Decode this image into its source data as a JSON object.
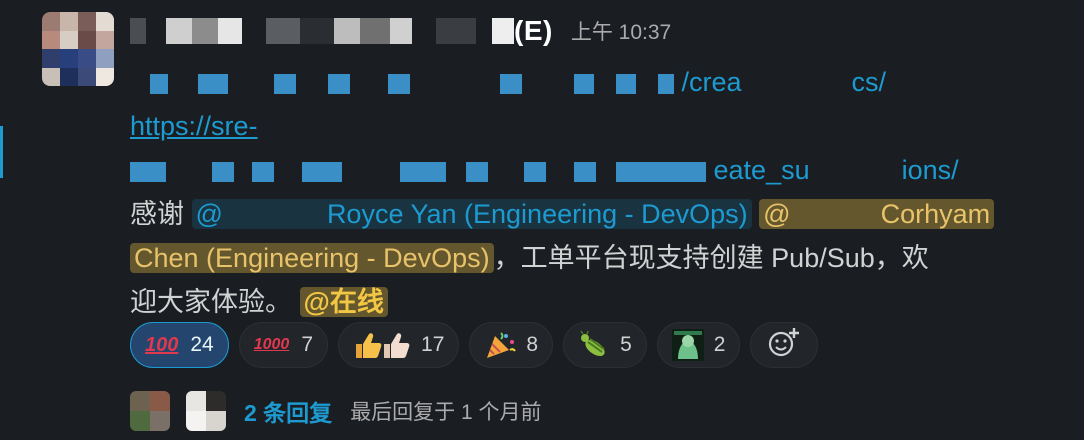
{
  "message": {
    "sender": "(E)",
    "timestamp": "上午 10:37",
    "link_line1_suffix": "/crea",
    "link_line1_end": "cs/",
    "link_line2": "https://sre-",
    "link_line3_a": "eate_su",
    "link_line3_b": "ions/",
    "text_thanks": "感谢",
    "mention1": "@",
    "mention1_name": "Royce Yan (Engineering - DevOps)",
    "mention2": "@",
    "mention2_name": "Corhyam",
    "mention2_cont": "Chen (Engineering - DevOps)",
    "body_text": "，工单平台现支持创建 Pub/Sub，欢",
    "body_text2": "迎大家体验。",
    "mention_online": "@在线"
  },
  "reactions": [
    {
      "name": "100",
      "count": "24",
      "active": true
    },
    {
      "name": "1000",
      "count": "7",
      "active": false
    },
    {
      "name": "thumbsup-skin-tones",
      "count": "17",
      "active": false
    },
    {
      "name": "party-popper",
      "count": "8",
      "active": false
    },
    {
      "name": "bug",
      "count": "5",
      "active": false
    },
    {
      "name": "custom-emoji",
      "count": "2",
      "active": false
    }
  ],
  "thread": {
    "reply_count": "2 条回复",
    "last_reply": "最后回复于 1 个月前"
  },
  "colors": {
    "link": "#1d9bd1",
    "mention_yellow": "#f2c744",
    "background": "#1a1d21"
  }
}
